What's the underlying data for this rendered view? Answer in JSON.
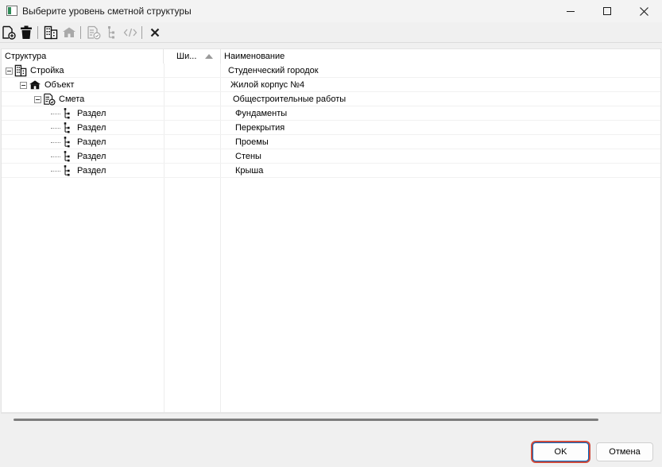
{
  "window": {
    "title": "Выберите уровень сметной структуры",
    "icon": "app-window-icon"
  },
  "toolbar": {
    "buttons": [
      {
        "name": "add-document-icon",
        "enabled": true
      },
      {
        "name": "trash-icon",
        "enabled": true
      },
      {
        "name": "building-icon",
        "enabled": true
      },
      {
        "name": "house-icon",
        "enabled": false
      },
      {
        "name": "estimate-doc-icon",
        "enabled": false
      },
      {
        "name": "section-tree-icon",
        "enabled": false
      },
      {
        "name": "code-brackets-icon",
        "enabled": false
      },
      {
        "name": "close-x-icon",
        "enabled": true
      }
    ]
  },
  "grid": {
    "columns": {
      "structure": "Структура",
      "code": "Ши...",
      "name": "Наименование"
    },
    "rows": [
      {
        "type": "Стройка",
        "name": "Студенческий городок",
        "icon": "building-icon",
        "level": 0,
        "expanded": true
      },
      {
        "type": "Объект",
        "name": "Жилой корпус №4",
        "icon": "house-icon",
        "level": 1,
        "expanded": true
      },
      {
        "type": "Смета",
        "name": "Общестроительные работы",
        "icon": "estimate-doc-icon",
        "level": 2,
        "expanded": true
      },
      {
        "type": "Раздел",
        "name": "Фундаменты",
        "icon": "section-icon",
        "level": 3
      },
      {
        "type": "Раздел",
        "name": "Перекрытия",
        "icon": "section-icon",
        "level": 3
      },
      {
        "type": "Раздел",
        "name": "Проемы",
        "icon": "section-icon",
        "level": 3
      },
      {
        "type": "Раздел",
        "name": "Стены",
        "icon": "section-icon",
        "level": 3
      },
      {
        "type": "Раздел",
        "name": "Крыша",
        "icon": "section-icon",
        "level": 3
      }
    ]
  },
  "footer": {
    "ok_label": "OK",
    "cancel_label": "Отмена"
  },
  "colors": {
    "ok_highlight": "#cf4b3c",
    "ok_border": "#0067c0"
  }
}
